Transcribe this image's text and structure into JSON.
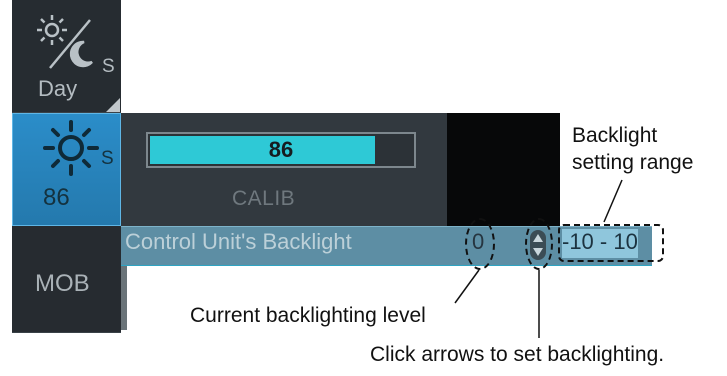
{
  "sidebar": {
    "daynight_button": {
      "icon": "sun-moon-icon",
      "badge": "S",
      "label": "Day",
      "corner": "dropdown-corner-icon"
    },
    "brightness_button": {
      "icon": "sun-icon",
      "badge": "S",
      "value": "86"
    },
    "mob_button": {
      "label": "MOB"
    }
  },
  "brightness_panel": {
    "bar_value": "86",
    "bar_level_percent": 86,
    "calib_label": "CALIB"
  },
  "backlight_row": {
    "label": "Control Unit's Backlight",
    "level": "0",
    "arrows_icon": "up-down-arrows-icon",
    "range": "-10 - 10"
  },
  "annotations": {
    "range_title": "Backlight setting range",
    "range_line1": "Backlight",
    "range_line2": "setting range",
    "current_level": "Current backlighting level",
    "arrows_hint": "Click arrows to set backlighting."
  },
  "colors": {
    "accent_cyan": "#2ec9d6",
    "active_button_blue": "#2b8dc9",
    "row_highlight": "#5d8ea4"
  }
}
